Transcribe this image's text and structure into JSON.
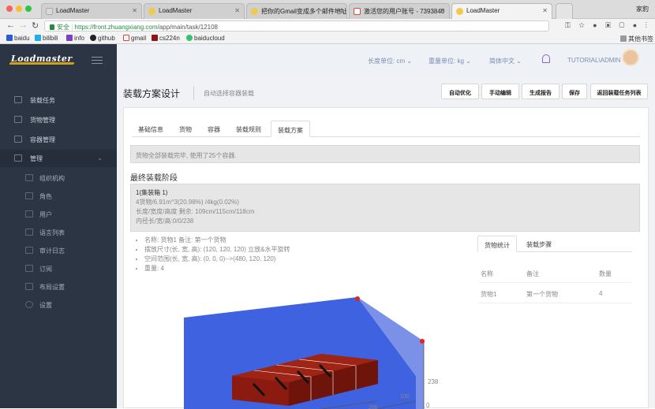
{
  "browser": {
    "tabs": [
      {
        "title": "LoadMaster",
        "active": false
      },
      {
        "title": "LoadMaster",
        "active": false
      },
      {
        "title": "把你的Gmail变成多个邮件地址",
        "active": false
      },
      {
        "title": "激活您的用户账号 - 7393840",
        "active": false
      },
      {
        "title": "LoadMaster",
        "active": true
      }
    ],
    "user_label": "家豹",
    "url_secure": "安全",
    "url_host": "https://front.zhuangxiang.com",
    "url_path": "/app/main/task/12108",
    "bookmarks": [
      "baidu",
      "bilibili",
      "info",
      "github",
      "gmail",
      "cs224n",
      "baiducloud"
    ],
    "other_bookmarks": "其他书签"
  },
  "app": {
    "logo_text": "Loadmaster",
    "sidebar": {
      "items": [
        {
          "label": "装载任务",
          "icon": "task-icon"
        },
        {
          "label": "货物管理",
          "icon": "cargo-icon"
        },
        {
          "label": "容器管理",
          "icon": "container-icon"
        },
        {
          "label": "管理",
          "icon": "admin-icon"
        }
      ],
      "sub_items": [
        {
          "label": "组织机构"
        },
        {
          "label": "角色"
        },
        {
          "label": "用户"
        },
        {
          "label": "语言列表"
        },
        {
          "label": "审计日志"
        },
        {
          "label": "订阅"
        },
        {
          "label": "布局设置"
        },
        {
          "label": "设置"
        }
      ]
    },
    "topbar": {
      "length_unit": "长度单位: cm",
      "weight_unit": "重量单位: kg",
      "language": "简体中文",
      "user": "TUTORIAL\\ADMIN"
    },
    "page": {
      "title": "装载方案设计",
      "subtitle": "自动选择容器装载",
      "actions": [
        "自动优化",
        "手动编辑",
        "生成报告",
        "保存",
        "返回装载任务列表"
      ],
      "tabs": [
        "基础信息",
        "货物",
        "容器",
        "装载规则",
        "装载方案"
      ],
      "active_tab": "装载方案",
      "alert": "货物全部装载完毕, 使用了25个容器.",
      "stage_title": "最终装载阶段",
      "box": {
        "name": "1(集装箱 1)",
        "line1": "4货物/6.91m^3(20.98%) /4kg(0.02%)",
        "line2": "长度/宽度/高度 剩余: 109cm/115cm/118cm",
        "line3": "内径长/宽/高:0/0/238"
      },
      "details": [
        "名称: 货物1 备注: 第一个货物",
        "摆放尺寸(长, 宽, 高): (120, 120, 120) 立放&水平旋转",
        "空间范围(长, 宽, 高): (0, 0, 0)-->(480, 120, 120)",
        "重量: 4"
      ],
      "viz_labels": {
        "height": "238",
        "zero": "0",
        "depth": "100",
        "width": "200"
      },
      "stats": {
        "tabs": [
          "货物统计",
          "装载步骤"
        ],
        "active": "货物统计",
        "headers": [
          "名称",
          "备注",
          "数量"
        ],
        "rows": [
          {
            "name": "货物1",
            "note": "第一个货物",
            "qty": "4"
          }
        ]
      }
    }
  }
}
